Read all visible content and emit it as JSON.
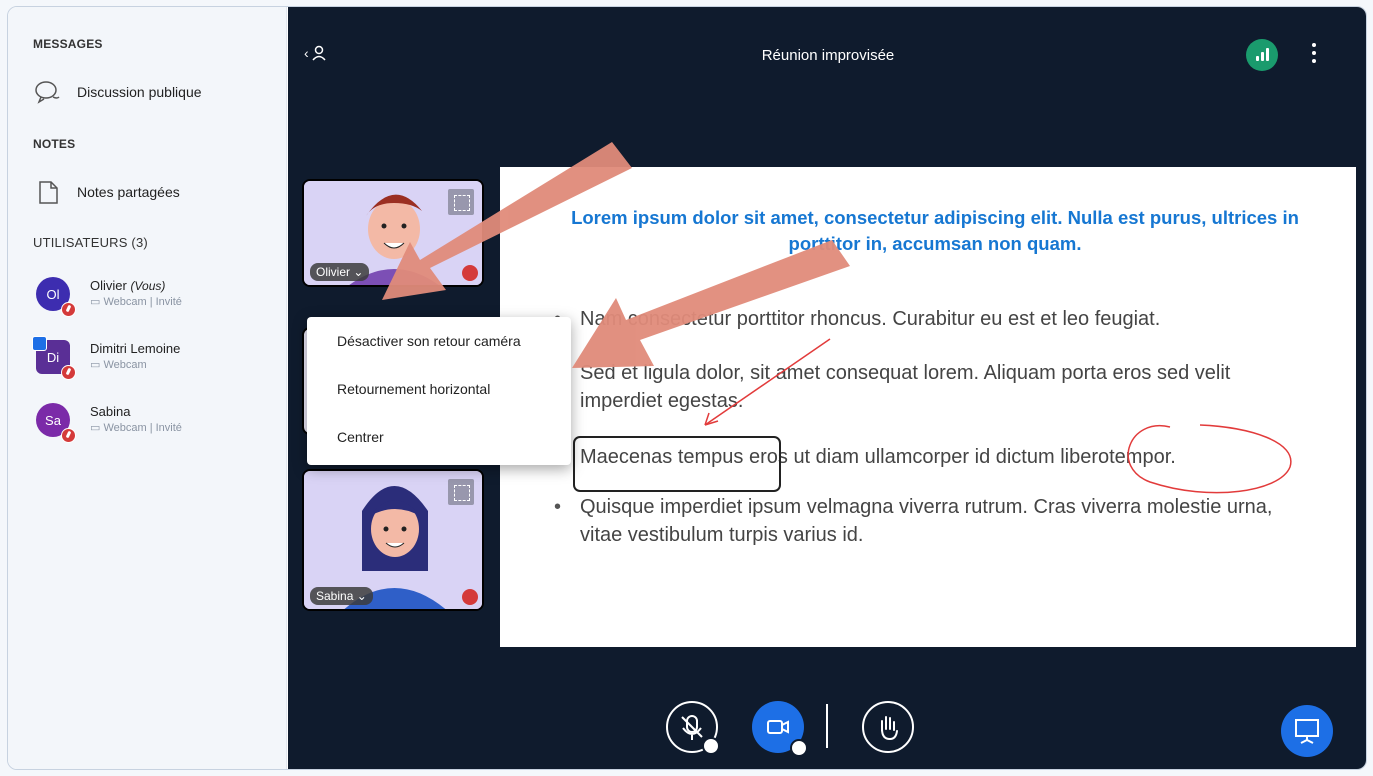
{
  "sidebar": {
    "messages_title": "MESSAGES",
    "public_chat": "Discussion publique",
    "notes_title": "NOTES",
    "shared_notes": "Notes partagées",
    "users_title": "UTILISATEURS (3)",
    "users": [
      {
        "initials": "Ol",
        "name": "Olivier",
        "you": "(Vous)",
        "role": "Webcam | Invité",
        "color": "#3d2db0"
      },
      {
        "initials": "Di",
        "name": "Dimitri Lemoine",
        "you": "",
        "role": "Webcam",
        "color": "#5a2f96"
      },
      {
        "initials": "Sa",
        "name": "Sabina",
        "you": "",
        "role": "Webcam | Invité",
        "color": "#7b2aa8"
      }
    ]
  },
  "header": {
    "title": "Réunion improvisée"
  },
  "slide": {
    "title": "Lorem ipsum dolor sit amet, consectetur adipiscing elit. Nulla est purus, ultrices in porttitor in, accumsan non quam.",
    "bullets": [
      "Nam consectetur porttitor rhoncus. Curabitur eu est et leo feugiat.",
      "Sed et ligula dolor, sit amet consequat lorem. Aliquam porta eros sed velit imperdiet egestas.",
      "Maecenas tempus eros ut diam ullamcorper id dictum liberotempor.",
      "Quisque imperdiet ipsum velmagna viverra rutrum. Cras viverra molestie urna, vitae vestibulum turpis varius id."
    ]
  },
  "tiles": [
    {
      "label": "Olivier ⌄"
    },
    {
      "label": "Sabina ⌄"
    }
  ],
  "menu": {
    "items": [
      "Désactiver son retour caméra",
      "Retournement horizontal",
      "Centrer"
    ]
  },
  "colors": {
    "main_bg": "#0f1b2d",
    "accent_blue": "#1d6fe6",
    "title_blue": "#1677d2",
    "connection_green": "#1a9b6d",
    "mute_red": "#d43a3a",
    "arrow": "#e08b7a"
  }
}
